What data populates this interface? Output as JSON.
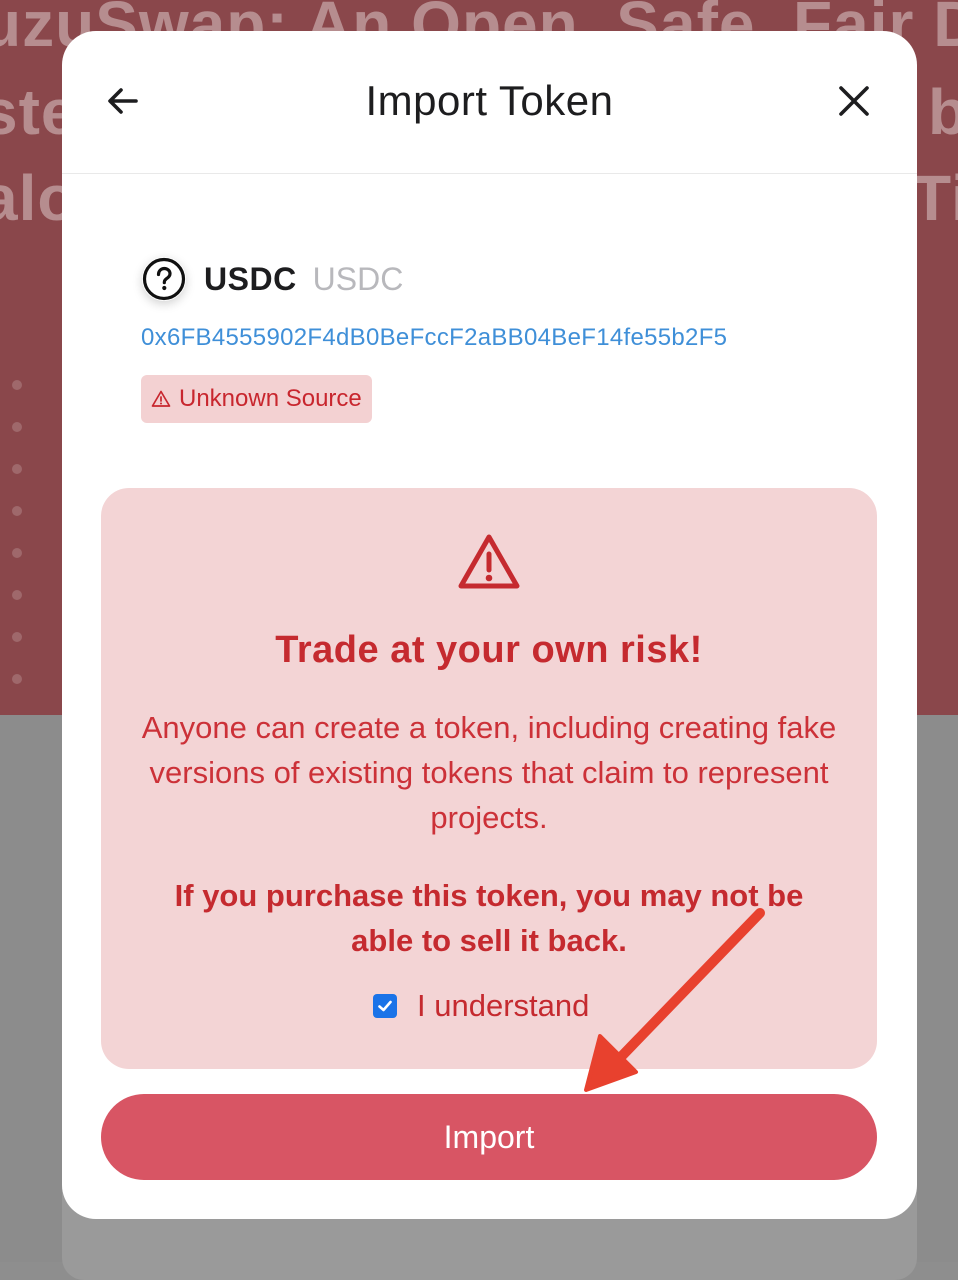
{
  "background": {
    "headline_lines": [
      "uzuSwap: An Open, Safe, Fair D",
      "ste",
      "alo"
    ],
    "right_fragments": [
      "b",
      "Ti"
    ]
  },
  "modal": {
    "title": "Import Token",
    "back_icon": "arrow-left-icon",
    "close_icon": "close-icon"
  },
  "token": {
    "icon": "question-circle-icon",
    "symbol": "USDC",
    "name": "USDC",
    "address": "0x6FB4555902F4dB0BeFccF2aBB04BeF14fe55b2F5",
    "source_badge": "Unknown Source"
  },
  "warning": {
    "icon": "warning-triangle-icon",
    "title": "Trade at your own risk!",
    "body": "Anyone can create a token, including creating fake versions of existing tokens that claim to represent projects.",
    "bold": "If you purchase this token, you may not be able to sell it back.",
    "checkbox_label": "I understand",
    "checkbox_checked": true
  },
  "import_button": {
    "label": "Import"
  },
  "colors": {
    "accent_red": "#d85564",
    "warning_text": "#c52a2f",
    "warning_bg": "#f3d4d5",
    "link_blue": "#3f8fd8",
    "annotation_arrow": "#e8412e"
  }
}
